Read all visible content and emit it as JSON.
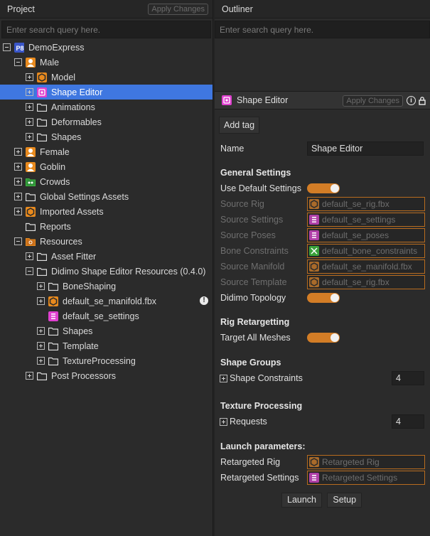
{
  "project": {
    "title": "Project",
    "apply_label": "Apply Changes",
    "search_placeholder": "Enter search query here.",
    "tree": {
      "root": "DemoExpress",
      "male": "Male",
      "model": "Model",
      "shape_editor": "Shape Editor",
      "animations": "Animations",
      "deformables": "Deformables",
      "shapes": "Shapes",
      "female": "Female",
      "goblin": "Goblin",
      "crowds": "Crowds",
      "global_settings": "Global Settings Assets",
      "imported": "Imported Assets",
      "reports": "Reports",
      "resources": "Resources",
      "asset_fitter": "Asset Fitter",
      "didimo": "Didimo Shape Editor Resources (0.4.0)",
      "boneshaping": "BoneShaping",
      "manifold": "default_se_manifold.fbx",
      "se_settings": "default_se_settings",
      "res_shapes": "Shapes",
      "template": "Template",
      "texproc": "TextureProcessing",
      "post": "Post Processors"
    },
    "warn_glyph": "!"
  },
  "outliner": {
    "title": "Outliner",
    "search_placeholder": "Enter search query here."
  },
  "editor": {
    "title": "Shape Editor",
    "apply_label": "Apply Changes",
    "info_glyph": "i",
    "add_tag": "Add tag",
    "name_label": "Name",
    "name_value": "Shape Editor",
    "general_settings": "General Settings",
    "use_default": "Use Default Settings",
    "source_rig": "Source Rig",
    "source_rig_val": "default_se_rig.fbx",
    "source_settings": "Source Settings",
    "source_settings_val": "default_se_settings",
    "source_poses": "Source Poses",
    "source_poses_val": "default_se_poses",
    "bone_constraints": "Bone Constraints",
    "bone_constraints_val": "default_bone_constraints",
    "source_manifold": "Source Manifold",
    "source_manifold_val": "default_se_manifold.fbx",
    "source_template": "Source Template",
    "source_template_val": "default_se_rig.fbx",
    "didimo_topology": "Didimo Topology",
    "rig_retargetting": "Rig Retargetting",
    "target_all": "Target All Meshes",
    "shape_groups": "Shape Groups",
    "shape_constraints": "Shape Constraints",
    "shape_constraints_val": "4",
    "texture_processing": "Texture Processing",
    "requests": "Requests",
    "requests_val": "4",
    "launch_params": "Launch parameters:",
    "retargeted_rig": "Retargeted Rig",
    "retargeted_rig_val": "Retargeted Rig",
    "retargeted_settings": "Retargeted Settings",
    "retargeted_settings_val": "Retargeted Settings",
    "launch": "Launch",
    "setup": "Setup"
  },
  "colors": {
    "selection": "#3f77e0",
    "accent_orange": "#d37d26",
    "magenta": "#e040d0",
    "green": "#3cba3c"
  }
}
